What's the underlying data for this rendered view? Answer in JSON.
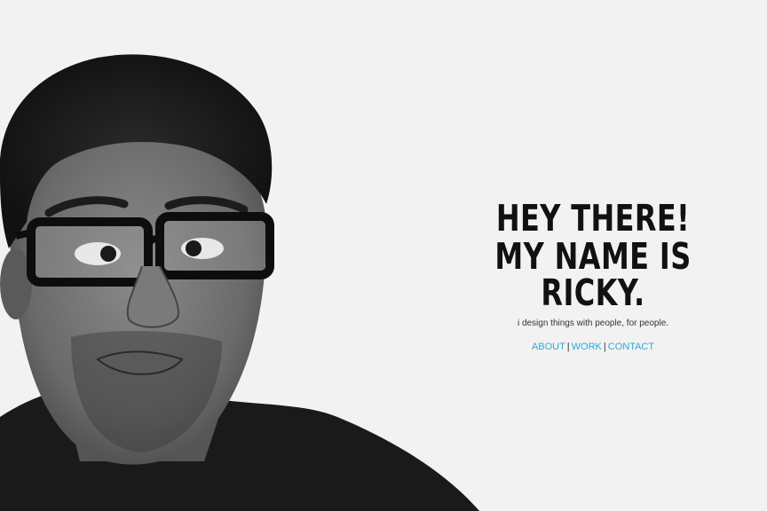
{
  "hero": {
    "headline_line1": "HEY THERE!",
    "headline_line2": "MY NAME IS RICKY.",
    "tagline": "i design things with people, for people."
  },
  "nav": {
    "items": [
      {
        "label": "ABOUT"
      },
      {
        "label": "WORK"
      },
      {
        "label": "CONTACT"
      }
    ],
    "separator": "|"
  },
  "colors": {
    "background": "#f2f2f2",
    "headline": "#111111",
    "link": "#2ea9d9"
  }
}
